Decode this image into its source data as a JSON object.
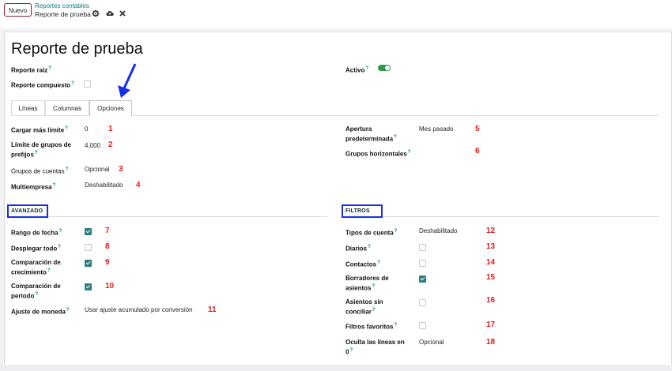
{
  "topbar": {
    "new_button": "Nuevo",
    "breadcrumb_parent": "Reportes contables",
    "breadcrumb_current": "Reporte de prueba",
    "icons": [
      "gear-icon",
      "cloud-upload-icon",
      "close-icon"
    ]
  },
  "form": {
    "title": "Reporte de prueba",
    "root_report_label": "Reporte raíz",
    "composite_report_label": "Reporte compuesto",
    "active_label": "Activo",
    "active_value": true,
    "help_mark": "?"
  },
  "tabs": [
    {
      "label": "Líneas",
      "active": false
    },
    {
      "label": "Columnas",
      "active": false
    },
    {
      "label": "Opciones",
      "active": true
    }
  ],
  "options_left": [
    {
      "label": "Cargar más límite",
      "value": "0",
      "marker": "1"
    },
    {
      "label": "Límite de grupos de prefijos",
      "value": "4,000",
      "marker": "2"
    },
    {
      "label": "Grupos de cuentas",
      "value": "Opcional",
      "marker": "3"
    },
    {
      "label": "Multiempresa",
      "value": "Deshabilitado",
      "marker": "4"
    }
  ],
  "options_right": [
    {
      "label": "Apertura predeterminada",
      "value": "Mes pasado",
      "marker": "5"
    },
    {
      "label": "Grupos horizontales",
      "value": "",
      "marker": "6"
    }
  ],
  "advanced": {
    "title": "AVANZADO",
    "rows": [
      {
        "label": "Rango de fecha",
        "checked": true,
        "marker": "7"
      },
      {
        "label": "Desplegar todo",
        "checked": false,
        "marker": "8"
      },
      {
        "label": "Comparación de crecimiento",
        "checked": true,
        "marker": "9"
      },
      {
        "label": "Comparación de periodo",
        "checked": true,
        "marker": "10"
      },
      {
        "label": "Ajuste de moneda",
        "value": "Usar ajuste acumulado por conversión",
        "marker": "11"
      }
    ]
  },
  "filters": {
    "title": "FILTROS",
    "rows": [
      {
        "label": "Tipos de cuenta",
        "value": "Deshabilitado",
        "marker": "12"
      },
      {
        "label": "Diarios",
        "checked": false,
        "marker": "13"
      },
      {
        "label": "Contactos",
        "checked": false,
        "marker": "14"
      },
      {
        "label": "Borradores de asientos",
        "checked": true,
        "marker": "15"
      },
      {
        "label": "Asientos sin conciliar",
        "checked": false,
        "marker": "16"
      },
      {
        "label": "Filtros favoritos",
        "checked": false,
        "marker": "17"
      },
      {
        "label": "Oculta las líneas en 0",
        "value": "Opcional",
        "marker": "18"
      }
    ]
  },
  "annotation_colors": {
    "marker": "#e21a1a",
    "highlight": "#1530e8"
  }
}
